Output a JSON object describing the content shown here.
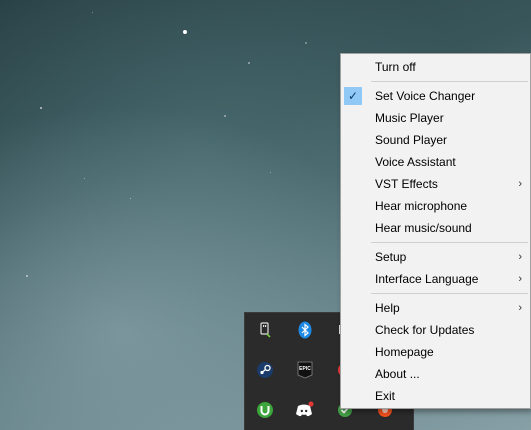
{
  "context_menu": {
    "items": [
      {
        "label": "Turn off",
        "separator_after": true
      },
      {
        "label": "Set Voice Changer",
        "checked": true
      },
      {
        "label": "Music Player"
      },
      {
        "label": "Sound Player"
      },
      {
        "label": "Voice Assistant"
      },
      {
        "label": "VST Effects",
        "has_submenu": true
      },
      {
        "label": "Hear microphone"
      },
      {
        "label": "Hear music/sound",
        "separator_after": true
      },
      {
        "label": "Setup",
        "has_submenu": true
      },
      {
        "label": "Interface Language",
        "has_submenu": true,
        "separator_after": true
      },
      {
        "label": "Help",
        "has_submenu": true
      },
      {
        "label": "Check for Updates"
      },
      {
        "label": "Homepage"
      },
      {
        "label": "About ..."
      },
      {
        "label": "Exit"
      }
    ],
    "check_glyph": "✓",
    "submenu_glyph": "›",
    "colors": {
      "background": "#f2f2f2",
      "check_highlight": "#90c8f6",
      "separator": "#d0d0d0"
    }
  },
  "tray": {
    "icons": [
      {
        "name": "usb-eject-icon",
        "color": "#e0e0e0"
      },
      {
        "name": "bluetooth-icon",
        "color": "#1e88e5"
      },
      {
        "name": "generic-tray-icon",
        "color": "#e0e0e0"
      },
      {
        "name": "steam-icon",
        "color": "#1b3c6b"
      },
      {
        "name": "epic-games-icon",
        "color": "#111111",
        "text": "EPIC"
      },
      {
        "name": "red-app-icon",
        "color": "#e53935"
      },
      {
        "name": "utorrent-icon",
        "color": "#3ca53c"
      },
      {
        "name": "discord-icon",
        "color": "#ffffff"
      },
      {
        "name": "green-check-app-icon",
        "color": "#43a047"
      },
      {
        "name": "orange-app-icon",
        "color": "#f4511e"
      }
    ],
    "colors": {
      "background": "#2b2b2b"
    }
  }
}
